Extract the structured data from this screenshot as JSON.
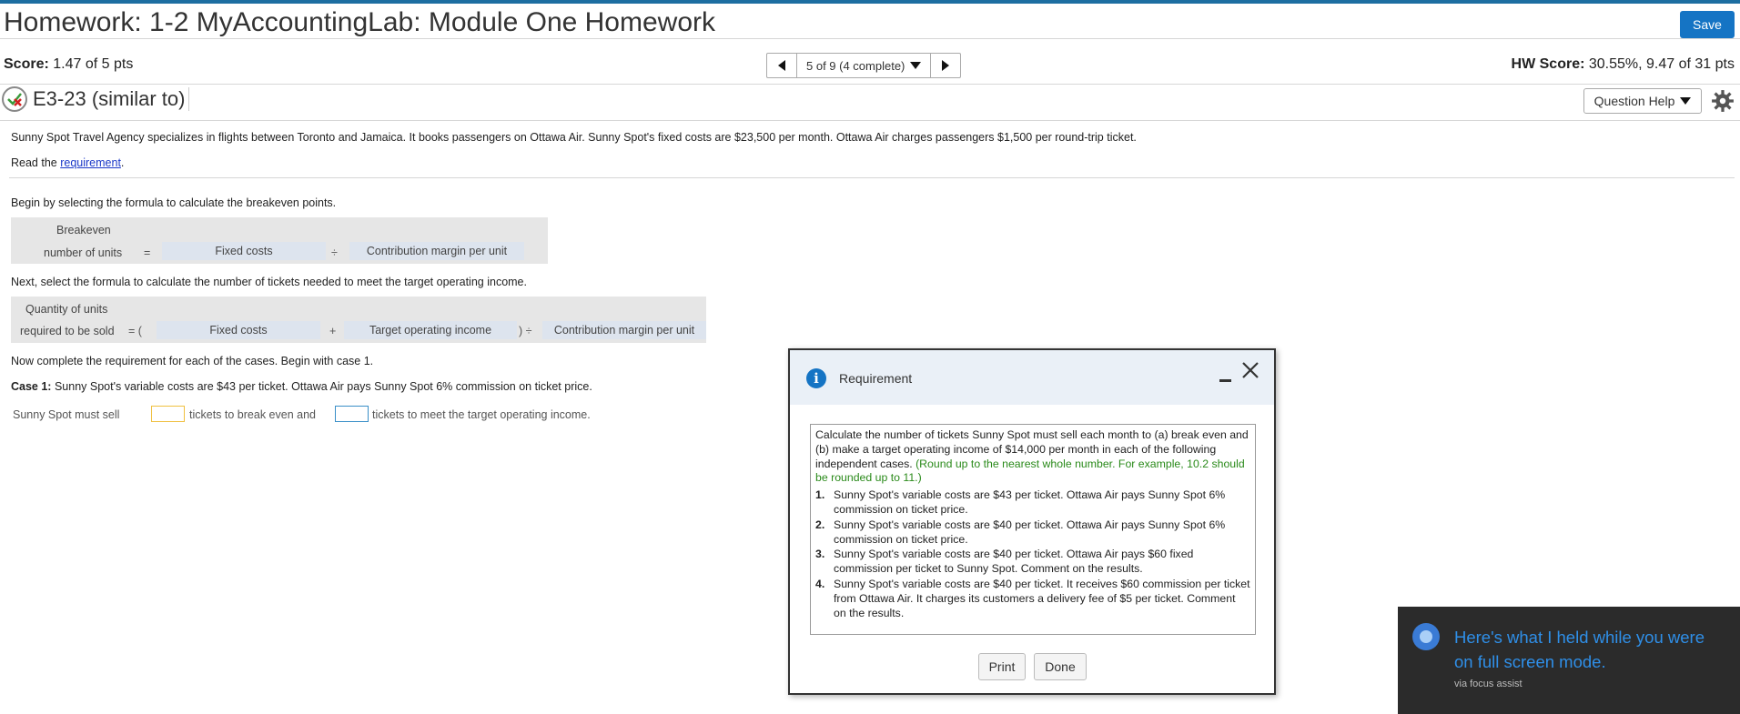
{
  "header": {
    "title": "Homework: 1-2 MyAccountingLab: Module One Homework",
    "save_label": "Save"
  },
  "scorebar": {
    "score_label": "Score:",
    "score_value": "1.47 of 5 pts",
    "nav_status": "5 of 9 (4 complete)",
    "hw_score_label": "HW Score:",
    "hw_score_value": "30.55%, 9.47 of 31 pts"
  },
  "question": {
    "id": "E3-23 (similar to)",
    "help_label": "Question Help"
  },
  "content": {
    "intro": "Sunny Spot Travel Agency specializes in flights between Toronto and Jamaica. It books passengers on Ottawa Air. Sunny Spot's fixed costs are $23,500 per month. Ottawa Air charges passengers $1,500 per round-trip ticket.",
    "read_prefix": "Read the ",
    "read_link": "requirement",
    "read_suffix": ".",
    "step1": "Begin by selecting the formula to calculate the breakeven points.",
    "formula1": {
      "label_line1": "Breakeven",
      "label_line2": "number of units",
      "eq": "=",
      "box1": "Fixed costs",
      "op": "÷",
      "box2": "Contribution margin per unit"
    },
    "step2": "Next, select the formula to calculate the number of tickets needed to meet the target operating income.",
    "formula2": {
      "label_line1": "Quantity of units",
      "label_line2": "required to be sold",
      "eq": "= (",
      "box1": "Fixed costs",
      "plus": "+",
      "box2": "Target operating income",
      "close": ") ÷",
      "box3": "Contribution margin per unit"
    },
    "step3": "Now complete the requirement for each of the cases. Begin with case 1.",
    "case1_label": "Case 1:",
    "case1_text": " Sunny Spot's variable costs are $43 per ticket. Ottawa Air pays Sunny Spot 6% commission on ticket price.",
    "answer_prefix": "Sunny Spot must sell",
    "answer_mid": "tickets to break even and",
    "answer_suffix": "tickets to meet the target operating income."
  },
  "dialog": {
    "title": "Requirement",
    "body_main": "Calculate the number of tickets Sunny Spot must sell each month to (a) break even and (b) make a target operating income of $14,000 per month in each of the following independent cases. ",
    "body_note": "(Round up to the nearest whole number. For example, 10.2 should be rounded up to 11.)",
    "items": [
      {
        "n": "1.",
        "text": "Sunny Spot's variable costs are $43 per ticket. Ottawa Air pays Sunny Spot 6% commission on ticket price."
      },
      {
        "n": "2.",
        "text": "Sunny Spot's variable costs are $40 per ticket. Ottawa Air pays Sunny Spot 6% commission on ticket price."
      },
      {
        "n": "3.",
        "text": "Sunny Spot's variable costs are $40 per ticket. Ottawa Air pays $60 fixed commission per ticket to Sunny Spot. Comment on the results."
      },
      {
        "n": "4.",
        "text": "Sunny Spot's variable costs are $40 per ticket. It receives $60 commission per ticket from Ottawa Air. It charges its customers a delivery fee of $5 per ticket. Comment on the results."
      }
    ],
    "print_label": "Print",
    "done_label": "Done"
  },
  "toast": {
    "message": "Here's what I held while you were on full screen mode.",
    "source": "via focus assist"
  },
  "colors": {
    "accent": "#1574c4",
    "link": "#1a38c8",
    "note_green": "#2a8a1a",
    "answer_box_1": "#f0c040",
    "answer_box_2": "#3a8fc8"
  }
}
